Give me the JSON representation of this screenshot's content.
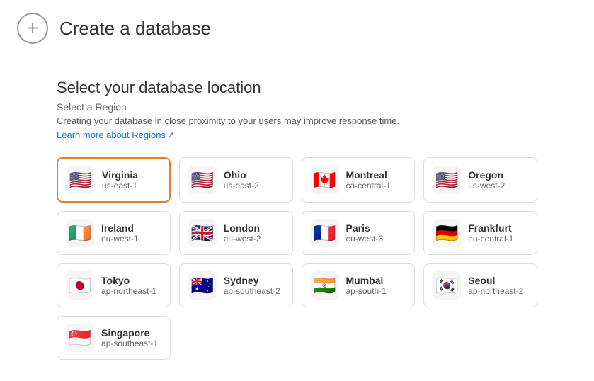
{
  "header": {
    "icon_label": "+",
    "title": "Create a database"
  },
  "section": {
    "title": "Select your database location",
    "subtitle": "Select a Region",
    "desc": "Creating your database in close proximity to your users may improve response time.",
    "learn_more_text": "Learn more about Regions",
    "external_icon": "🔗"
  },
  "regions": [
    {
      "id": "virginia",
      "name": "Virginia",
      "code": "us-east-1",
      "flag": "🇺🇸",
      "selected": true
    },
    {
      "id": "ohio",
      "name": "Ohio",
      "code": "us-east-2",
      "flag": "🇺🇸",
      "selected": false
    },
    {
      "id": "montreal",
      "name": "Montreal",
      "code": "ca-central-1",
      "flag": "🇨🇦",
      "selected": false
    },
    {
      "id": "oregon",
      "name": "Oregon",
      "code": "us-west-2",
      "flag": "🇺🇸",
      "selected": false
    },
    {
      "id": "ireland",
      "name": "Ireland",
      "code": "eu-west-1",
      "flag": "🇮🇪",
      "selected": false
    },
    {
      "id": "london",
      "name": "London",
      "code": "eu-west-2",
      "flag": "🇬🇧",
      "selected": false
    },
    {
      "id": "paris",
      "name": "Paris",
      "code": "eu-west-3",
      "flag": "🇫🇷",
      "selected": false
    },
    {
      "id": "frankfurt",
      "name": "Frankfurt",
      "code": "eu-central-1",
      "flag": "🇩🇪",
      "selected": false
    },
    {
      "id": "tokyo",
      "name": "Tokyo",
      "code": "ap-northeast-1",
      "flag": "🇯🇵",
      "selected": false
    },
    {
      "id": "sydney",
      "name": "Sydney",
      "code": "ap-southeast-2",
      "flag": "🇦🇺",
      "selected": false
    },
    {
      "id": "mumbai",
      "name": "Mumbai",
      "code": "ap-south-1",
      "flag": "🇮🇳",
      "selected": false
    },
    {
      "id": "seoul",
      "name": "Seoul",
      "code": "ap-northeast-2",
      "flag": "🇰🇷",
      "selected": false
    },
    {
      "id": "singapore",
      "name": "Singapore",
      "code": "ap-southeast-1",
      "flag": "🇸🇬",
      "selected": false
    }
  ]
}
